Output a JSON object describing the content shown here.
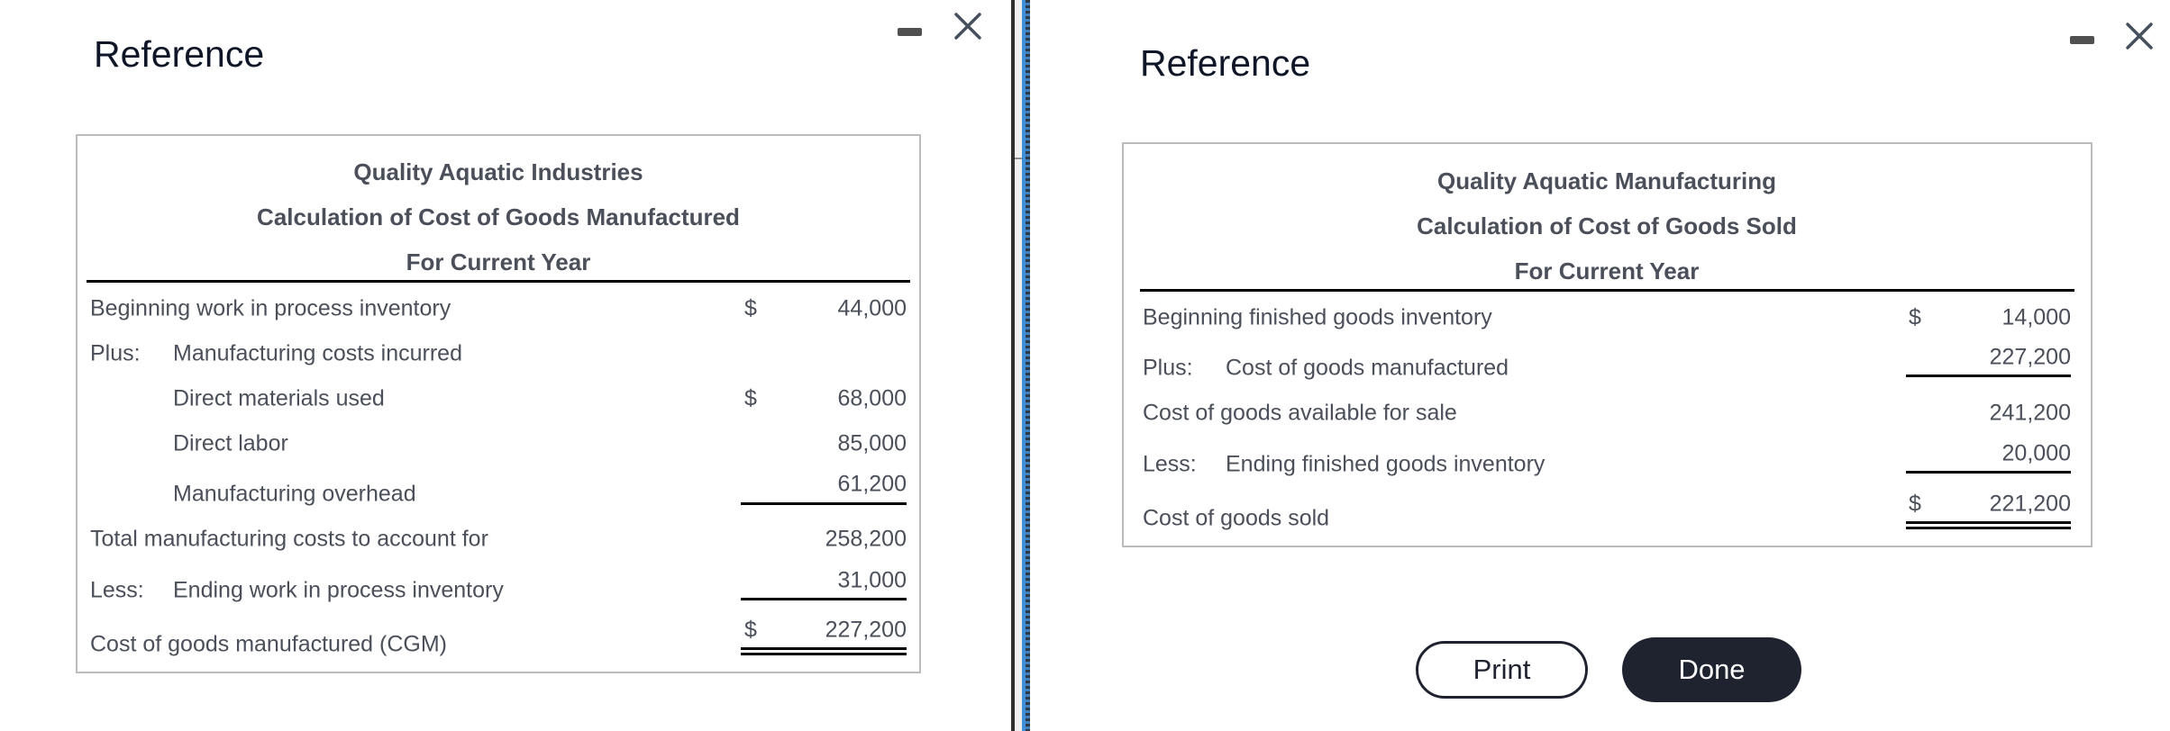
{
  "left_panel": {
    "title": "Reference",
    "controls": {
      "minimize": "minimize-icon",
      "close": "close-icon"
    },
    "statement": {
      "company": "Quality Aquatic Industries",
      "title": "Calculation of Cost of Goods Manufactured",
      "period": "For Current Year",
      "rows": [
        {
          "prefix": "",
          "label": "Beginning work in process inventory",
          "currency": "$",
          "col1": "",
          "col2": "44,000"
        },
        {
          "prefix": "Plus:",
          "label": "Manufacturing costs incurred",
          "currency": "",
          "col1": "",
          "col2": ""
        },
        {
          "prefix": "",
          "label": "Direct materials used",
          "currency": "$",
          "col1": "68,000",
          "col2": ""
        },
        {
          "prefix": "",
          "label": "Direct labor",
          "currency": "",
          "col1": "85,000",
          "col2": ""
        },
        {
          "prefix": "",
          "label": "Manufacturing overhead",
          "currency": "",
          "col1": "61,200",
          "col2": ""
        },
        {
          "prefix": "",
          "label": "Total manufacturing costs to account for",
          "currency": "",
          "col1": "",
          "col2": "258,200"
        },
        {
          "prefix": "Less:",
          "label": "Ending work in process inventory",
          "currency": "",
          "col1": "",
          "col2": "31,000"
        },
        {
          "prefix": "",
          "label": "Cost of goods manufactured (CGM)",
          "currency": "$",
          "col1": "",
          "col2": "227,200"
        }
      ]
    }
  },
  "right_panel": {
    "title": "Reference",
    "controls": {
      "minimize": "minimize-icon",
      "close": "close-icon"
    },
    "statement": {
      "company": "Quality Aquatic Manufacturing",
      "title": "Calculation of Cost of Goods Sold",
      "period": "For Current Year",
      "rows": [
        {
          "prefix": "",
          "label": "Beginning finished goods inventory",
          "currency": "$",
          "value": "14,000"
        },
        {
          "prefix": "Plus:",
          "label": "Cost of goods manufactured",
          "currency": "",
          "value": "227,200"
        },
        {
          "prefix": "",
          "label": "Cost of goods available for sale",
          "currency": "",
          "value": "241,200"
        },
        {
          "prefix": "Less:",
          "label": "Ending finished goods inventory",
          "currency": "",
          "value": "20,000"
        },
        {
          "prefix": "",
          "label": "Cost of goods sold",
          "currency": "$",
          "value": "221,200"
        }
      ]
    },
    "buttons": {
      "print": "Print",
      "done": "Done"
    }
  },
  "colors": {
    "title": "#0e1628",
    "text": "#4a4f5a",
    "button_dark": "#1f2330",
    "box_border": "#bcbcbc",
    "divider_blue": "#3f8fd6"
  }
}
